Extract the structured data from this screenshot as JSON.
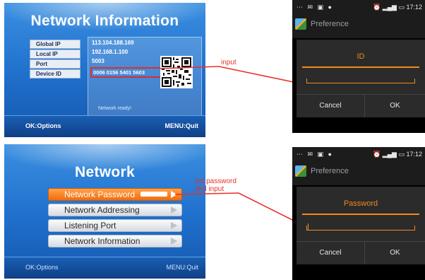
{
  "tv_network_information": {
    "title": "Network Information",
    "labels": [
      "Global IP",
      "Local IP",
      "Port",
      "Device ID"
    ],
    "values": {
      "global_ip": "113.104.188.169",
      "local_ip": "192.168.1.100",
      "port": "5003",
      "device_id": "0006 0156 5401 5603"
    },
    "status": "Network ready!",
    "footer_left": "OK:Options",
    "footer_right": "MENU:Quit"
  },
  "tv_network_menu": {
    "title": "Network",
    "items": [
      {
        "label": "Network Password",
        "selected": true
      },
      {
        "label": "Network Addressing",
        "selected": false
      },
      {
        "label": "Listening Port",
        "selected": false
      },
      {
        "label": "Network Information",
        "selected": false
      }
    ],
    "footer_left": "OK:Options",
    "footer_right": "MENU:Quit"
  },
  "annotations": {
    "input": "input",
    "set_password_line1": "set password",
    "set_password_line2": "and input"
  },
  "phone_id_dialog": {
    "status_time": "17:12",
    "app_title": "Preference",
    "dialog_title": "ID",
    "cancel_label": "Cancel",
    "ok_label": "OK"
  },
  "phone_password_dialog": {
    "status_time": "17:12",
    "app_title": "Preference",
    "dialog_title": "Password",
    "cancel_label": "Cancel",
    "ok_label": "OK"
  },
  "colors": {
    "accent_orange": "#f08a1c",
    "annotation_red": "#e8302a",
    "tv_blue": "#1f6fcc"
  }
}
